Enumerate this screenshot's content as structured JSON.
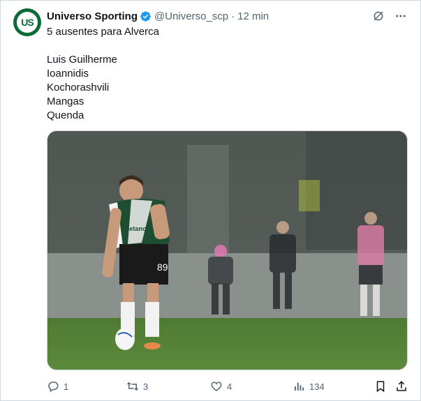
{
  "account": {
    "avatar_text": "US",
    "display_name": "Universo Sporting",
    "handle": "@Universo_scp",
    "separator": "·",
    "time": "12 min",
    "brand_color": "#0a6b37",
    "verified_color": "#1d9bf0"
  },
  "tweet": {
    "intro": "5 ausentes para Alverca",
    "players": [
      "Luis Guilherme",
      "Ioannidis",
      "Kochorashvili",
      "Mangas",
      "Quenda"
    ]
  },
  "media": {
    "description_icon": "soccer-photo",
    "jersey_number": "89",
    "sponsor": "betano"
  },
  "actions": {
    "replies": "1",
    "retweets": "3",
    "likes": "4",
    "views": "134"
  },
  "icons": {
    "grok": "grok-icon",
    "more": "more-icon",
    "reply": "reply-icon",
    "retweet": "retweet-icon",
    "like": "like-icon",
    "views": "views-icon",
    "bookmark": "bookmark-icon",
    "share": "share-icon"
  }
}
